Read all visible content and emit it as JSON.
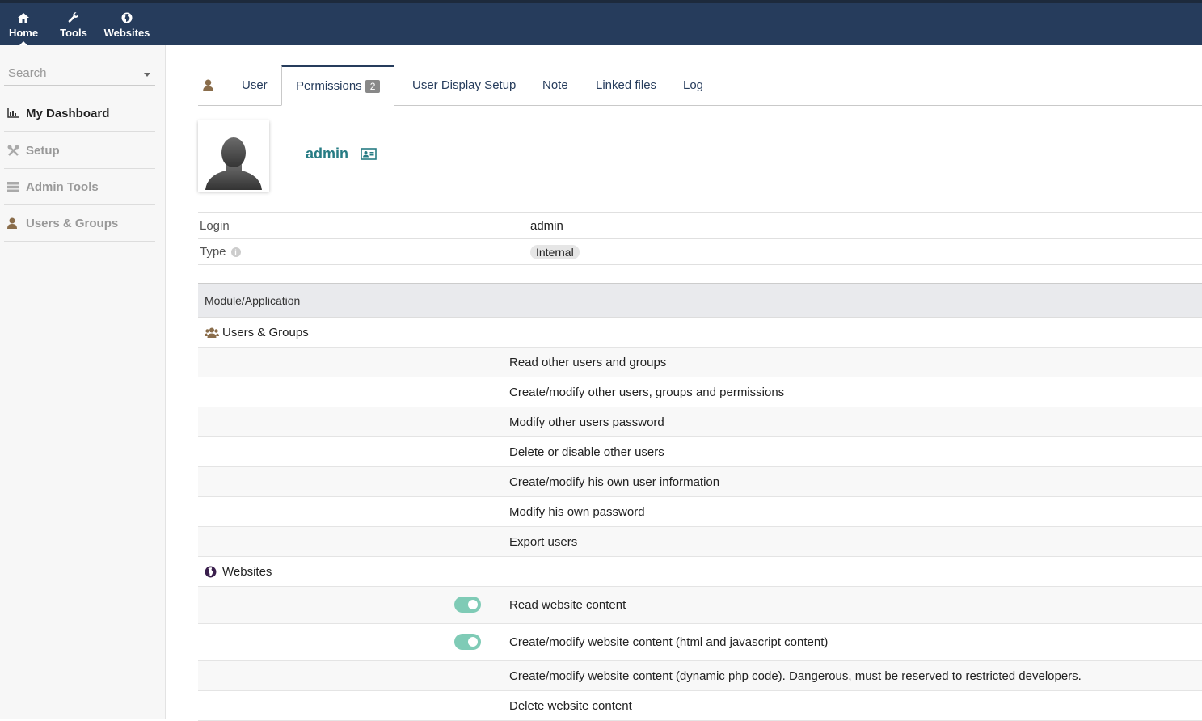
{
  "topmenu": [
    {
      "label": "Home",
      "icon": "home-icon"
    },
    {
      "label": "Tools",
      "icon": "wrench-icon"
    },
    {
      "label": "Websites",
      "icon": "globe-icon"
    }
  ],
  "sidebar": {
    "search_placeholder": "Search",
    "items": [
      {
        "label": "My Dashboard",
        "icon": "chart-icon"
      },
      {
        "label": "Setup",
        "icon": "tools-icon"
      },
      {
        "label": "Admin Tools",
        "icon": "server-icon"
      },
      {
        "label": "Users & Groups",
        "icon": "user-icon"
      }
    ]
  },
  "tabs": [
    {
      "label": "User"
    },
    {
      "label": "Permissions",
      "badge": "2"
    },
    {
      "label": "User Display Setup"
    },
    {
      "label": "Note"
    },
    {
      "label": "Linked files"
    },
    {
      "label": "Log"
    }
  ],
  "user": {
    "name": "admin",
    "login_label": "Login",
    "login_value": "admin",
    "type_label": "Type",
    "type_value": "Internal"
  },
  "permissions": {
    "header": "Module/Application",
    "groups": [
      {
        "name": "Users & Groups",
        "icon": "users-icon",
        "items": [
          {
            "label": "Read other users and groups",
            "enabled": false
          },
          {
            "label": "Create/modify other users, groups and permissions",
            "enabled": false
          },
          {
            "label": "Modify other users password",
            "enabled": false
          },
          {
            "label": "Delete or disable other users",
            "enabled": false
          },
          {
            "label": "Create/modify his own user information",
            "enabled": false
          },
          {
            "label": "Modify his own password",
            "enabled": false
          },
          {
            "label": "Export users",
            "enabled": false
          }
        ]
      },
      {
        "name": "Websites",
        "icon": "globe-icon",
        "items": [
          {
            "label": "Read website content",
            "enabled": true
          },
          {
            "label": "Create/modify website content (html and javascript content)",
            "enabled": true
          },
          {
            "label": "Create/modify website content (dynamic php code). Dangerous, must be reserved to restricted developers.",
            "enabled": false
          },
          {
            "label": "Delete website content",
            "enabled": false
          }
        ]
      }
    ]
  },
  "colors": {
    "topbar": "#263c5c",
    "username": "#277c84",
    "toggle_on": "#7fcbb6"
  }
}
